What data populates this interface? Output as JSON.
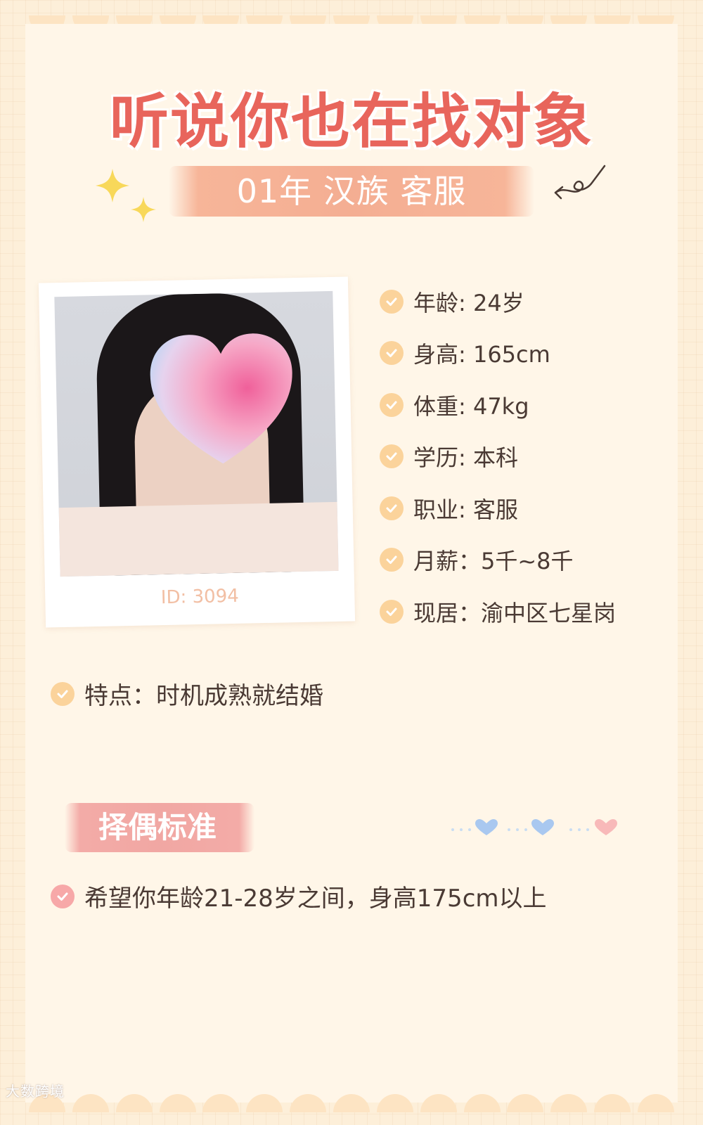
{
  "title": "听说你也在找对象",
  "subtitle": "01年  汉族 客服",
  "photo": {
    "id_label": "ID: 3094"
  },
  "profile": [
    {
      "text": "年龄: 24岁",
      "icon": "check-icon"
    },
    {
      "text": "身高: 165cm",
      "icon": "check-icon"
    },
    {
      "text": "体重: 47kg",
      "icon": "check-icon"
    },
    {
      "text": "学历: 本科",
      "icon": "check-icon"
    },
    {
      "text": "职业: 客服",
      "icon": "check-icon"
    },
    {
      "text": "月薪：5千~8千",
      "icon": "check-icon"
    },
    {
      "text": "现居：渝中区七星岗",
      "icon": "check-icon"
    }
  ],
  "feature": "特点：时机成熟就结婚",
  "criteria_section": {
    "label": "择偶标准",
    "text": "希望你年龄21-28岁之间，身高175cm以上"
  },
  "watermark": "大数跨境",
  "colors": {
    "background": "#fdefd9",
    "card": "#fff6e8",
    "title": "#e8655c",
    "subtitle_brush": "#f3a689",
    "check_yellow": "#fbd39b",
    "check_pink": "#f7a8a8",
    "section_brush": "#ef9e9b",
    "text": "#4a3a34"
  }
}
